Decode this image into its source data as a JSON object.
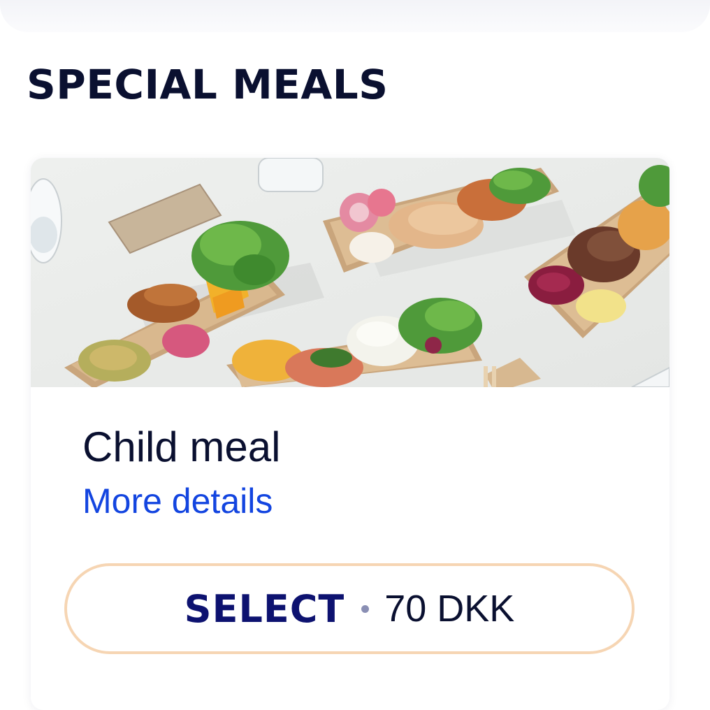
{
  "section": {
    "title": "SPECIAL MEALS"
  },
  "meal": {
    "image_alt": "Assorted special meal trays with salads, chicken and vegetables",
    "name": "Child meal",
    "details_link": "More details",
    "select_label": "SELECT",
    "price": "70 DKK"
  },
  "colors": {
    "title": "#0a1030",
    "link": "#1345e0",
    "select_text": "#0d1270",
    "button_border": "#f6d5b3"
  }
}
